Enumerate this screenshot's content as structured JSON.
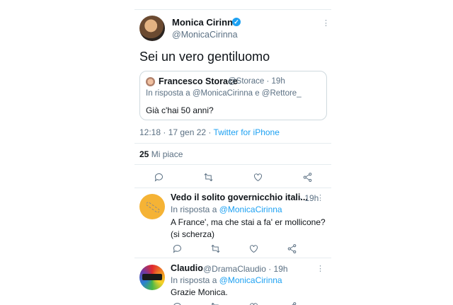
{
  "main_tweet": {
    "author_name": "Monica Cirinnà",
    "author_handle": "@MonicaCirinna",
    "text": "Sei un vero gentiluomo",
    "quote": {
      "name": "Francesco Storace",
      "meta": "@Storace · 19h",
      "reply_to": "In risposta a @MonicaCirinna e @Rettore_",
      "text": "Già c'hai 50 anni?"
    },
    "time": "12:18 · 17 gen 22 · ",
    "source": "Twitter for iPhone",
    "likes_count": "25",
    "likes_label": " Mi piace"
  },
  "replies": [
    {
      "name": "Vedo il solito governicchio itali...",
      "meta": "· 19h",
      "reply_prefix": "In risposta a ",
      "reply_mention": "@MonicaCirinna",
      "text": "A France', ma che stai a fa' er mollicone? (si scherza)"
    },
    {
      "name": "Claudio",
      "meta": "@DramaClaudio · 19h",
      "reply_prefix": "In risposta a ",
      "reply_mention": "@MonicaCirinna",
      "text": "Grazie Monica."
    }
  ],
  "icons": {
    "more": "⋮",
    "verified": "✓"
  },
  "colors": {
    "accent": "#1da1f2",
    "secondary_text": "#5b7083",
    "divider": "#e6ecf0"
  }
}
